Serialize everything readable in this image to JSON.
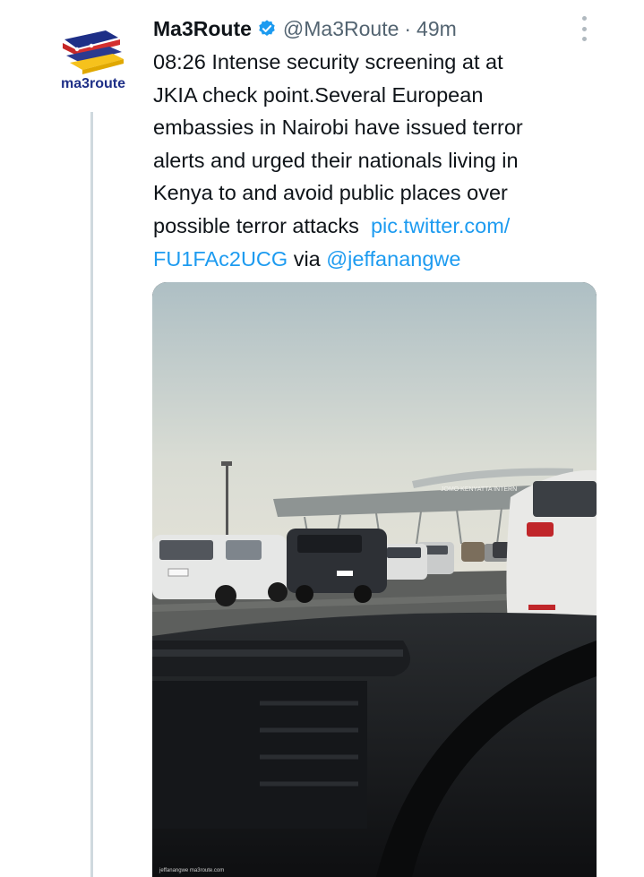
{
  "tweet": {
    "author_name": "Ma3Route",
    "handle": "@Ma3Route",
    "separator": "·",
    "time": "49m",
    "verified": true,
    "text_lines": [
      "08:26 Intense security screening at at",
      "JKIA check point.Several European",
      "embassies in Nairobi have issued terror",
      "alerts and urged their nationals living in",
      "Kenya to and avoid public places over"
    ],
    "line6_text": "possible terror attacks",
    "link_part1": "pic.twitter.com/",
    "link_part2": "FU1FAc2UCG",
    "via_text": "via",
    "mention": "@jeffanangwe"
  },
  "avatar": {
    "logo_text": "ma3route",
    "icon": "ma3route-logo"
  },
  "media": {
    "sign_text": "JOMO KENYATTA INTERN",
    "watermark": "jeffanangwe  ma3route.com"
  },
  "colors": {
    "link": "#1d9bf0",
    "verified": "#1d9bf0",
    "muted": "#536471",
    "text": "#0f1419"
  }
}
